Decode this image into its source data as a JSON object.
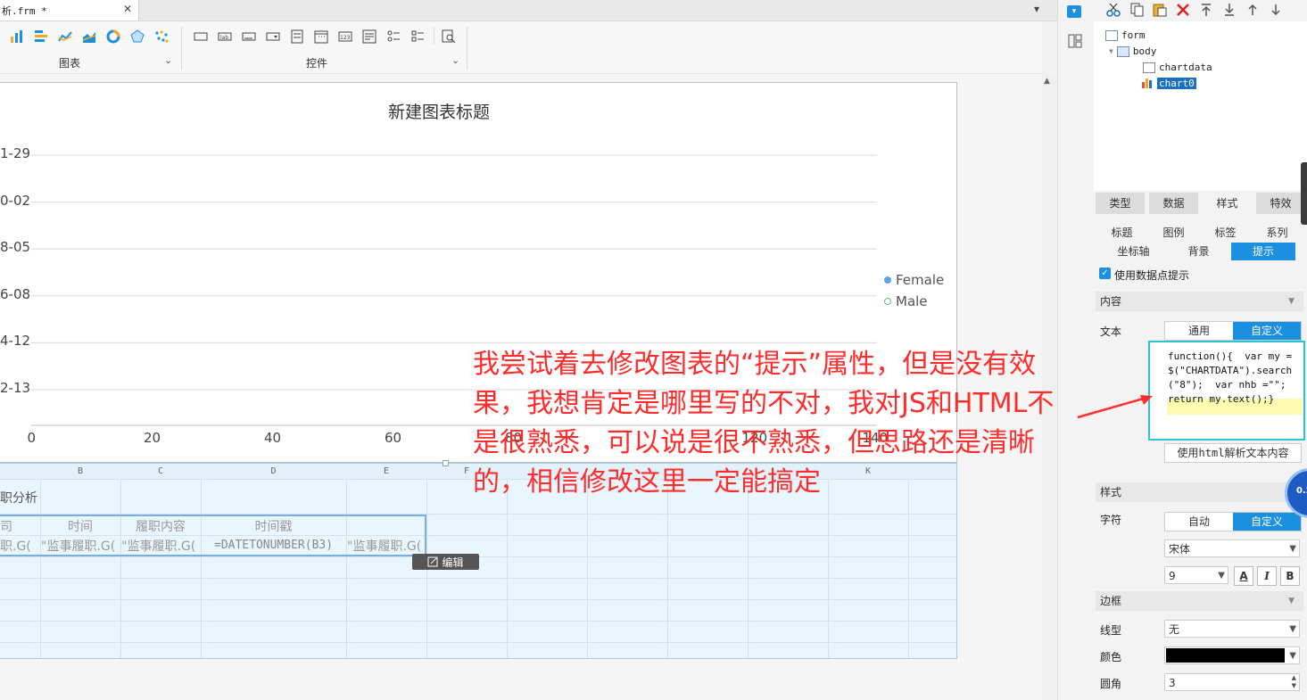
{
  "tab": {
    "title": "析.frm *",
    "close": "✕",
    "menu": "▾"
  },
  "toolbar": {
    "groups": [
      {
        "label": "图表",
        "arrow": "⌄"
      },
      {
        "label": "控件",
        "arrow": "⌄"
      }
    ]
  },
  "chart": {
    "title": "新建图表标题",
    "yticks": [
      "1-29",
      "0-02",
      "8-05",
      "6-08",
      "4-12",
      "2-13"
    ],
    "xticks": [
      "0",
      "20",
      "40",
      "60",
      "80",
      "120",
      "140"
    ],
    "legend": [
      {
        "name": "Female",
        "color": "#5aa3e8"
      },
      {
        "name": "Male",
        "color": "#5bbf73"
      }
    ]
  },
  "chart_data": {
    "type": "scatter",
    "title": "新建图表标题",
    "series": [
      {
        "name": "Female",
        "values": []
      },
      {
        "name": "Male",
        "values": []
      }
    ],
    "xticks": [
      "0",
      "20",
      "40",
      "60",
      "80",
      "120",
      "140"
    ],
    "yticks": [
      "1-29",
      "0-02",
      "8-05",
      "6-08",
      "4-12",
      "2-13"
    ],
    "legend_position": "right",
    "grid": true
  },
  "sheet": {
    "columns": [
      "B",
      "C",
      "D",
      "E",
      "F",
      "K"
    ],
    "row1": {
      "a": "职分析"
    },
    "row2": {
      "a": "司",
      "b": "时间",
      "c": "履职内容",
      "d": "时间戳"
    },
    "row3": {
      "a": "职.G(",
      "b": "\"监事履职.G(",
      "c": "\"监事履职.G(",
      "d": "=DATETONUMBER(B3)",
      "e": "\"监事履职.G("
    },
    "edit_button": "编辑"
  },
  "tree": {
    "items": [
      "form",
      "body",
      "chartdata",
      "chart0"
    ]
  },
  "panel": {
    "main_tabs": [
      "类型",
      "数据",
      "样式",
      "特效"
    ],
    "sub_tabs_row1": [
      "标题",
      "图例",
      "标签",
      "系列"
    ],
    "sub_tabs_row2": [
      "坐标轴",
      "背景",
      "提示"
    ],
    "use_point_tip": "使用数据点提示",
    "content_section": "内容",
    "text_label": "文本",
    "text_modes": [
      "通用",
      "自定义"
    ],
    "code": "function(){  var my =$(\"CHARTDATA\").search(\"8\");  var nhb =\"\";    return my.text();}",
    "html_parse_button": "使用html解析文本内容",
    "style_section": "样式",
    "char_label": "字符",
    "char_modes": [
      "自动",
      "自定义"
    ],
    "font_name": "宋体",
    "font_size": "9",
    "format_buttons": [
      "A",
      "I",
      "B"
    ],
    "border_section": "边框",
    "line_type_label": "线型",
    "line_type_value": "无",
    "color_label": "颜色",
    "color_value": "#000000",
    "radius_label": "圆角",
    "radius_value": "3"
  },
  "annotation": {
    "text": "我尝试着去修改图表的“提示”属性，但是没有效果，我想肯定是哪里写的不对，我对JS和HTML不是很熟悉，可以说是很不熟悉，但思路还是清晰的，相信修改这里一定能搞定"
  },
  "floating": {
    "badge": "0.2"
  }
}
